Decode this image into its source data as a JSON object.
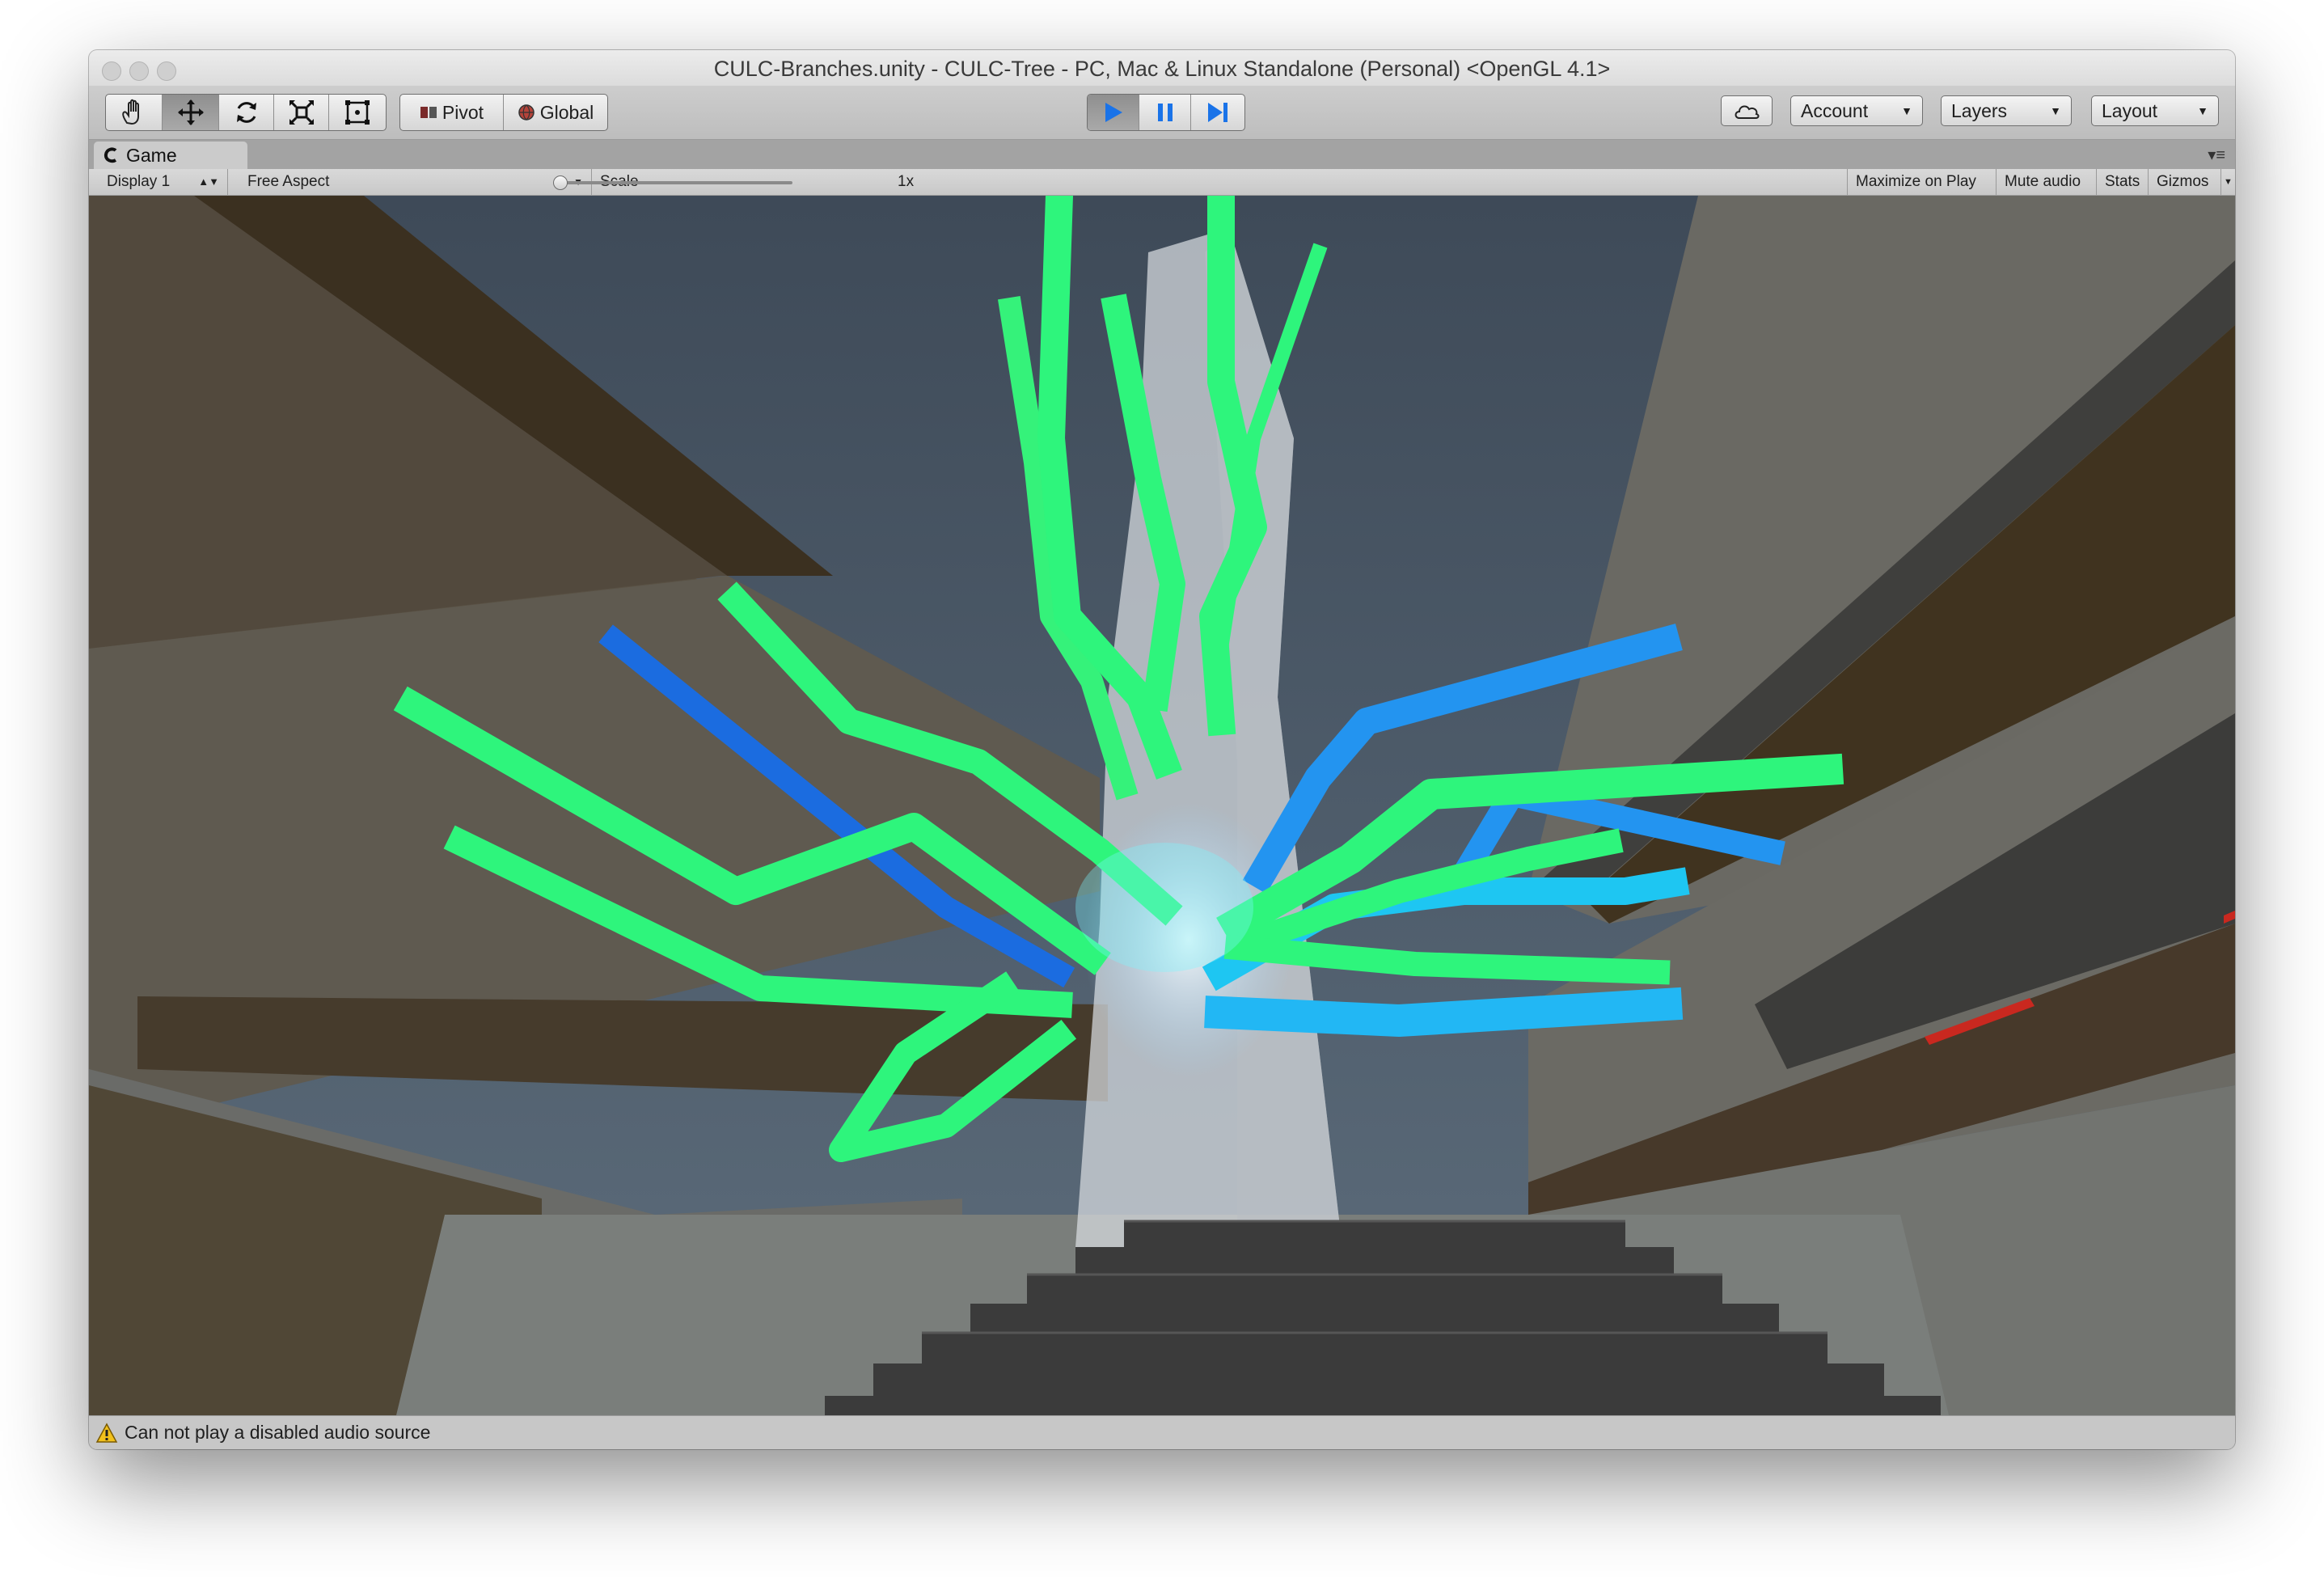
{
  "window": {
    "title": "CULC-Branches.unity - CULC-Tree - PC, Mac & Linux Standalone (Personal) <OpenGL 4.1>"
  },
  "toolbar": {
    "tools": [
      {
        "name": "hand-tool",
        "icon": "hand-icon"
      },
      {
        "name": "move-tool",
        "icon": "move-arrows-icon",
        "active": true
      },
      {
        "name": "rotate-tool",
        "icon": "rotate-icon"
      },
      {
        "name": "scale-tool",
        "icon": "scale-icon"
      },
      {
        "name": "rect-tool",
        "icon": "rect-icon"
      }
    ],
    "pivot_label": "Pivot",
    "global_label": "Global",
    "playback": {
      "play_icon": "play-icon",
      "pause_icon": "pause-icon",
      "step_icon": "step-icon",
      "play_active": true
    },
    "cloud_icon": "cloud-icon",
    "account_label": "Account",
    "layers_label": "Layers",
    "layout_label": "Layout"
  },
  "tab": {
    "game_label": "Game",
    "menu_icon": "panel-menu-icon"
  },
  "game_toolbar": {
    "display": "Display 1",
    "aspect": "Free Aspect",
    "scale_label": "Scale",
    "scale_value": "1x",
    "maximize_label": "Maximize on Play",
    "mute_label": "Mute audio",
    "stats_label": "Stats",
    "gizmos_label": "Gizmos"
  },
  "status": {
    "message": "Can not play a disabled audio source",
    "icon": "warning-icon"
  },
  "colors": {
    "branch_green": "#2cf57a",
    "branch_blue": "#1f8cf0",
    "branch_cyan": "#18e2f2",
    "sky": "#4a5866",
    "wall_brown": "#3d3121",
    "stairs": "#3c3c3c",
    "accent_red": "#d12a23"
  }
}
